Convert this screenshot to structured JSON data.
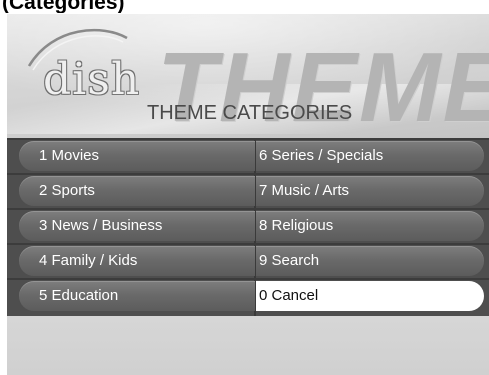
{
  "caption": "(Categories)",
  "brand": {
    "logo_text": "dish"
  },
  "header": {
    "background_word": "THEME",
    "title": "THEME CATEGORIES"
  },
  "menu": {
    "selected_index": 9,
    "items": [
      {
        "label": "1 Movies"
      },
      {
        "label": "6 Series / Specials"
      },
      {
        "label": "2 Sports"
      },
      {
        "label": "7 Music / Arts"
      },
      {
        "label": "3 News / Business"
      },
      {
        "label": "8 Religious"
      },
      {
        "label": "4 Family / Kids"
      },
      {
        "label": "9 Search"
      },
      {
        "label": "5 Education"
      },
      {
        "label": "0 Cancel"
      }
    ]
  },
  "colors": {
    "menu_item": "#6a6a6a",
    "menu_text": "#ffffff",
    "selected_bg": "#ffffff",
    "screen_bg": "#d0d0d0"
  }
}
